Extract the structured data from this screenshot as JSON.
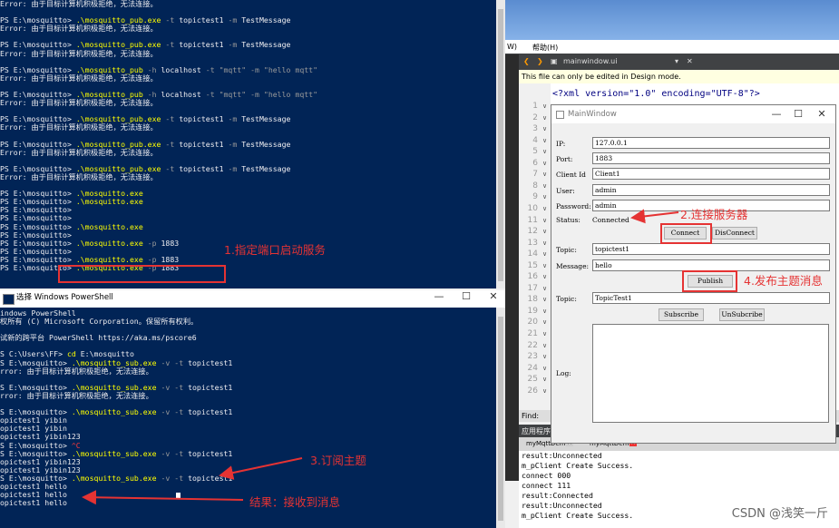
{
  "ps_top": {
    "lines": [
      [
        {
          "t": "Error: 由于目标计算机积极拒绝，无法连接。"
        }
      ],
      [],
      [
        {
          "t": "PS E:\\mosquitto> "
        },
        {
          "t": ".\\mosquitto_pub.exe",
          "c": "y"
        },
        {
          "t": " -t ",
          "c": "g"
        },
        {
          "t": "topictest1 "
        },
        {
          "t": "-m ",
          "c": "g"
        },
        {
          "t": "TestMessage"
        }
      ],
      [
        {
          "t": "Error: 由于目标计算机积极拒绝，无法连接。"
        }
      ],
      [],
      [
        {
          "t": "PS E:\\mosquitto> "
        },
        {
          "t": ".\\mosquitto_pub.exe",
          "c": "y"
        },
        {
          "t": " -t ",
          "c": "g"
        },
        {
          "t": "topictest1 "
        },
        {
          "t": "-m ",
          "c": "g"
        },
        {
          "t": "TestMessage"
        }
      ],
      [
        {
          "t": "Error: 由于目标计算机积极拒绝，无法连接。"
        }
      ],
      [],
      [
        {
          "t": "PS E:\\mosquitto> "
        },
        {
          "t": ".\\mosquitto_pub",
          "c": "y"
        },
        {
          "t": " -h ",
          "c": "g"
        },
        {
          "t": "localhost "
        },
        {
          "t": "-t ",
          "c": "g"
        },
        {
          "t": "\"mqtt\" ",
          "c": "g"
        },
        {
          "t": "-m ",
          "c": "g"
        },
        {
          "t": "\"hello mqtt\"",
          "c": "g"
        }
      ],
      [
        {
          "t": "Error: 由于目标计算机积极拒绝，无法连接。"
        }
      ],
      [],
      [
        {
          "t": "PS E:\\mosquitto> "
        },
        {
          "t": ".\\mosquitto_pub",
          "c": "y"
        },
        {
          "t": " -h ",
          "c": "g"
        },
        {
          "t": "localhost "
        },
        {
          "t": "-t ",
          "c": "g"
        },
        {
          "t": "\"mqtt\" ",
          "c": "g"
        },
        {
          "t": "-m ",
          "c": "g"
        },
        {
          "t": "\"hello mqtt\"",
          "c": "g"
        }
      ],
      [
        {
          "t": "Error: 由于目标计算机积极拒绝，无法连接。"
        }
      ],
      [],
      [
        {
          "t": "PS E:\\mosquitto> "
        },
        {
          "t": ".\\mosquitto_pub.exe",
          "c": "y"
        },
        {
          "t": " -t ",
          "c": "g"
        },
        {
          "t": "topictest1 "
        },
        {
          "t": "-m ",
          "c": "g"
        },
        {
          "t": "TestMessage"
        }
      ],
      [
        {
          "t": "Error: 由于目标计算机积极拒绝，无法连接。"
        }
      ],
      [],
      [
        {
          "t": "PS E:\\mosquitto> "
        },
        {
          "t": ".\\mosquitto_pub.exe",
          "c": "y"
        },
        {
          "t": " -t ",
          "c": "g"
        },
        {
          "t": "topictest1 "
        },
        {
          "t": "-m ",
          "c": "g"
        },
        {
          "t": "TestMessage"
        }
      ],
      [
        {
          "t": "Error: 由于目标计算机积极拒绝，无法连接。"
        }
      ],
      [],
      [
        {
          "t": "PS E:\\mosquitto> "
        },
        {
          "t": ".\\mosquitto_pub.exe",
          "c": "y"
        },
        {
          "t": " -t ",
          "c": "g"
        },
        {
          "t": "topictest1 "
        },
        {
          "t": "-m ",
          "c": "g"
        },
        {
          "t": "TestMessage"
        }
      ],
      [
        {
          "t": "Error: 由于目标计算机积极拒绝，无法连接。"
        }
      ],
      [],
      [
        {
          "t": "PS E:\\mosquitto> "
        },
        {
          "t": ".\\mosquitto.exe",
          "c": "y"
        }
      ],
      [
        {
          "t": "PS E:\\mosquitto> "
        },
        {
          "t": ".\\mosquitto.exe",
          "c": "y"
        }
      ],
      [
        {
          "t": "PS E:\\mosquitto>"
        }
      ],
      [
        {
          "t": "PS E:\\mosquitto>"
        }
      ],
      [
        {
          "t": "PS E:\\mosquitto> "
        },
        {
          "t": ".\\mosquitto.exe",
          "c": "y"
        }
      ],
      [
        {
          "t": "PS E:\\mosquitto>"
        }
      ],
      [
        {
          "t": "PS E:\\mosquitto> "
        },
        {
          "t": ".\\mosquitto.exe",
          "c": "y"
        },
        {
          "t": " -p ",
          "c": "g"
        },
        {
          "t": "1883"
        }
      ],
      [
        {
          "t": "PS E:\\mosquitto>"
        }
      ],
      [
        {
          "t": "PS E:\\mosquitto> "
        },
        {
          "t": ".\\mosquitto.exe",
          "c": "y"
        },
        {
          "t": " -p ",
          "c": "g"
        },
        {
          "t": "1883"
        }
      ],
      [
        {
          "t": "PS E:\\mosquitto> "
        },
        {
          "t": ".\\mosquitto.exe",
          "c": "y"
        },
        {
          "t": " -p ",
          "c": "g"
        },
        {
          "t": "1883"
        }
      ]
    ]
  },
  "ps_bottom": {
    "title": "选择 Windows PowerShell",
    "lines": [
      [
        {
          "t": "indows PowerShell"
        }
      ],
      [
        {
          "t": "权所有 (C) Microsoft Corporation。保留所有权利。"
        }
      ],
      [],
      [
        {
          "t": "试新的跨平台 PowerShell https://aka.ms/pscore6"
        }
      ],
      [],
      [
        {
          "t": "S C:\\Users\\FF> "
        },
        {
          "t": "cd ",
          "c": "y"
        },
        {
          "t": "E:\\mosquitto"
        }
      ],
      [
        {
          "t": "S E:\\mosquitto> "
        },
        {
          "t": ".\\mosquitto_sub.exe",
          "c": "y"
        },
        {
          "t": " -v -t ",
          "c": "g"
        },
        {
          "t": "topictest1"
        }
      ],
      [
        {
          "t": "rror: 由于目标计算机积极拒绝，无法连接。"
        }
      ],
      [],
      [
        {
          "t": "S E:\\mosquitto> "
        },
        {
          "t": ".\\mosquitto_sub.exe",
          "c": "y"
        },
        {
          "t": " -v -t ",
          "c": "g"
        },
        {
          "t": "topictest1"
        }
      ],
      [
        {
          "t": "rror: 由于目标计算机积极拒绝，无法连接。"
        }
      ],
      [],
      [
        {
          "t": "S E:\\mosquitto> "
        },
        {
          "t": ".\\mosquitto_sub.exe",
          "c": "y"
        },
        {
          "t": " -v -t ",
          "c": "g"
        },
        {
          "t": "topictest1"
        }
      ],
      [
        {
          "t": "opictest1 yibin"
        }
      ],
      [
        {
          "t": "opictest1 yibin"
        }
      ],
      [
        {
          "t": "opictest1 yibin123"
        }
      ],
      [
        {
          "t": "S E:\\mosquitto> "
        },
        {
          "t": "^C",
          "c": "r"
        }
      ],
      [
        {
          "t": "S E:\\mosquitto> "
        },
        {
          "t": ".\\mosquitto_sub.exe",
          "c": "y"
        },
        {
          "t": " -v -t ",
          "c": "g"
        },
        {
          "t": "topictest1"
        }
      ],
      [
        {
          "t": "opictest1 yibin123"
        }
      ],
      [
        {
          "t": "opictest1 yibin123"
        }
      ],
      [
        {
          "t": "S E:\\mosquitto> "
        },
        {
          "t": ".\\mosquitto_sub.exe",
          "c": "y"
        },
        {
          "t": " -v -t ",
          "c": "g"
        },
        {
          "t": "topictest1"
        }
      ],
      [
        {
          "t": "opictest1 hello"
        }
      ],
      [
        {
          "t": "opictest1 hello"
        }
      ],
      [
        {
          "t": "opictest1 hello"
        }
      ]
    ]
  },
  "qt": {
    "menu_w": "W)",
    "menu_help": "帮助(H)",
    "file_tab": "mainwindow.ui",
    "info": "This file can only be edited in Design mode.",
    "code_line": "<?xml version=\"1.0\" encoding=\"UTF-8\"?>",
    "line_numbers": [
      "1",
      "2",
      "3",
      "4",
      "5",
      "6",
      "7",
      "8",
      "9",
      "10",
      "11",
      "12",
      "13",
      "14",
      "15",
      "16",
      "17",
      "18",
      "19",
      "20",
      "21",
      "22",
      "23",
      "24",
      "25",
      "26"
    ],
    "find_label": "Find:",
    "app_output_label": "应用程序",
    "tab1": "myMqttDemo",
    "tab2": "myMqttDemo",
    "output_lines": [
      "result:Unconnected",
      "m_pClient Create Success.",
      "connect 000",
      "connect 111",
      "result:Connected",
      "result:Unconnected",
      "m_pClient Create Success."
    ]
  },
  "mainwindow": {
    "title": "MainWindow",
    "ip_label": "IP:",
    "ip_value": "127.0.0.1",
    "port_label": "Port:",
    "port_value": "1883",
    "clientid_label": "Client Id",
    "clientid_value": "Client1",
    "user_label": "User:",
    "user_value": "admin",
    "password_label": "Password:",
    "password_value": "admin",
    "status_label": "Status:",
    "status_value": "Connected",
    "connect_btn": "Connect",
    "disconnect_btn": "DisConnect",
    "topic_label": "Topic:",
    "topic_value": "topictest1",
    "message_label": "Message:",
    "message_value": "hello",
    "publish_btn": "Publish",
    "topic2_label": "Topic:",
    "topic2_value": "TopicTest1",
    "subscribe_btn": "Subscribe",
    "unsubscribe_btn": "UnSubcribe",
    "log_label": "Log:"
  },
  "annotations": {
    "a1": "1.指定端口启动服务",
    "a2": "2.连接服务器",
    "a3": "3.订阅主题",
    "a4": "4.发布主题消息",
    "a5": "结果：接收到消息",
    "color": "#e53333"
  },
  "watermark": "CSDN @浅笑一斤"
}
